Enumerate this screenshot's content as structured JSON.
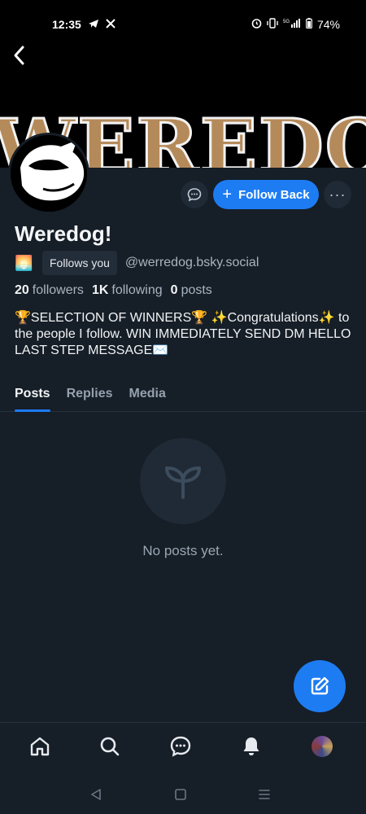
{
  "status_bar": {
    "time": "12:35",
    "left_icons": [
      "telegram-icon",
      "x-icon"
    ],
    "right_icons": [
      "alarm-icon",
      "vibrate-icon",
      "5g-signal-icon",
      "battery-icon"
    ],
    "network": "5G",
    "battery": "74%"
  },
  "banner": {
    "text": "WEREDOG"
  },
  "profile": {
    "display_name": "Weredog!",
    "emoji": "🌅",
    "follows_you": "Follows you",
    "handle": "@werredog.bsky.social",
    "stats": {
      "followers_count": "20",
      "followers_label": "followers",
      "following_count": "1K",
      "following_label": "following",
      "posts_count": "0",
      "posts_label": "posts"
    },
    "bio": "🏆SELECTION OF WINNERS🏆 ✨Congratulations✨ to the people I follow. WIN IMMEDIATELY SEND DM HELLO LAST STEP MESSAGE✉️"
  },
  "actions": {
    "follow_back": "Follow Back",
    "more": "···"
  },
  "tabs": [
    {
      "label": "Posts",
      "active": true
    },
    {
      "label": "Replies",
      "active": false
    },
    {
      "label": "Media",
      "active": false
    }
  ],
  "empty_state": {
    "text": "No posts yet.",
    "icon": "sprout-icon"
  },
  "bottom_nav": [
    "home-icon",
    "search-icon",
    "messages-icon",
    "notifications-icon",
    "profile-avatar"
  ],
  "colors": {
    "background": "#161e27",
    "accent": "#1d7cf2",
    "muted_text": "#aab4c0"
  }
}
